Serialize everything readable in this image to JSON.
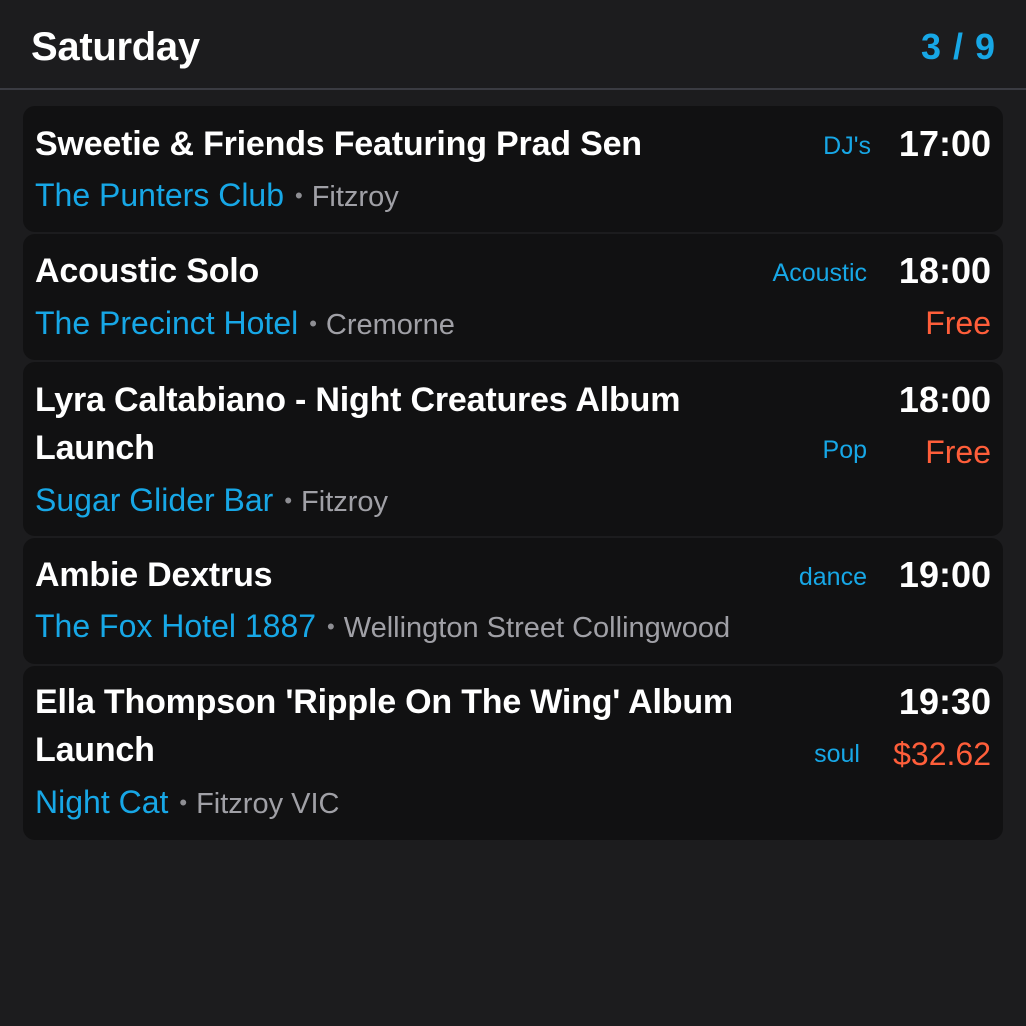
{
  "header": {
    "day": "Saturday",
    "pager": "3 / 9"
  },
  "events": [
    {
      "title": "Sweetie & Friends Featuring Prad Sen",
      "venue": "The Punters Club",
      "separator": "•",
      "suburb": "Fitzroy",
      "genre": "DJ's",
      "time": "17:00",
      "price": ""
    },
    {
      "title": "Acoustic Solo",
      "venue": "The Precinct Hotel",
      "separator": "•",
      "suburb": "Cremorne",
      "genre": "Acoustic",
      "time": "18:00",
      "price": "Free"
    },
    {
      "title_line1": "Lyra Caltabiano - Night Creatures Album",
      "title_line2": "Launch",
      "venue": "Sugar Glider Bar",
      "separator": "•",
      "suburb": "Fitzroy",
      "genre": "Pop",
      "time": "18:00",
      "price": "Free"
    },
    {
      "title": "Ambie Dextrus",
      "venue": "The Fox Hotel 1887",
      "separator": "•",
      "suburb": "Wellington Street Collingwood",
      "genre": "dance",
      "time": "19:00",
      "price": ""
    },
    {
      "title_line1": "Ella Thompson 'Ripple On The Wing' Album",
      "title_line2": "Launch",
      "venue": "Night Cat",
      "separator": "•",
      "suburb": "Fitzroy VIC",
      "genre": "soul",
      "time": "19:30",
      "price": "$32.62"
    }
  ],
  "colors": {
    "background": "#1c1c1e",
    "card": "#111112",
    "accent": "#17a7e6",
    "price": "#ff5e3a",
    "muted": "#a0a0a6"
  }
}
